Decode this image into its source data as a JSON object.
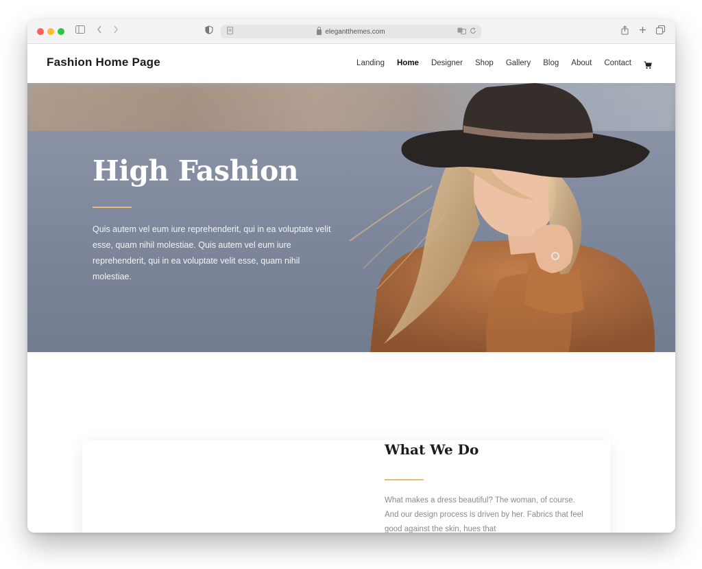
{
  "browser": {
    "url": "elegantthemes.com"
  },
  "site": {
    "logo": "Fashion Home Page",
    "nav": [
      {
        "label": "Landing"
      },
      {
        "label": "Home"
      },
      {
        "label": "Designer"
      },
      {
        "label": "Shop"
      },
      {
        "label": "Gallery"
      },
      {
        "label": "Blog"
      },
      {
        "label": "About"
      },
      {
        "label": "Contact"
      }
    ],
    "active_nav": "Home"
  },
  "hero": {
    "title": "High Fashion",
    "text": "Quis autem vel eum iure reprehenderit, qui in ea voluptate velit esse, quam nihil molestiae. Quis autem vel eum iure reprehenderit, qui in ea voluptate velit esse, quam nihil molestiae."
  },
  "section": {
    "title": "What We Do",
    "text": "What makes a dress beautiful? The woman, of course. And our design process is driven by her. Fabrics that feel good against the skin, hues that"
  },
  "colors": {
    "accent_gold": "#e3c06f",
    "traffic_red": "#fe5f57",
    "traffic_yellow": "#febc2e",
    "traffic_green": "#28c840"
  }
}
